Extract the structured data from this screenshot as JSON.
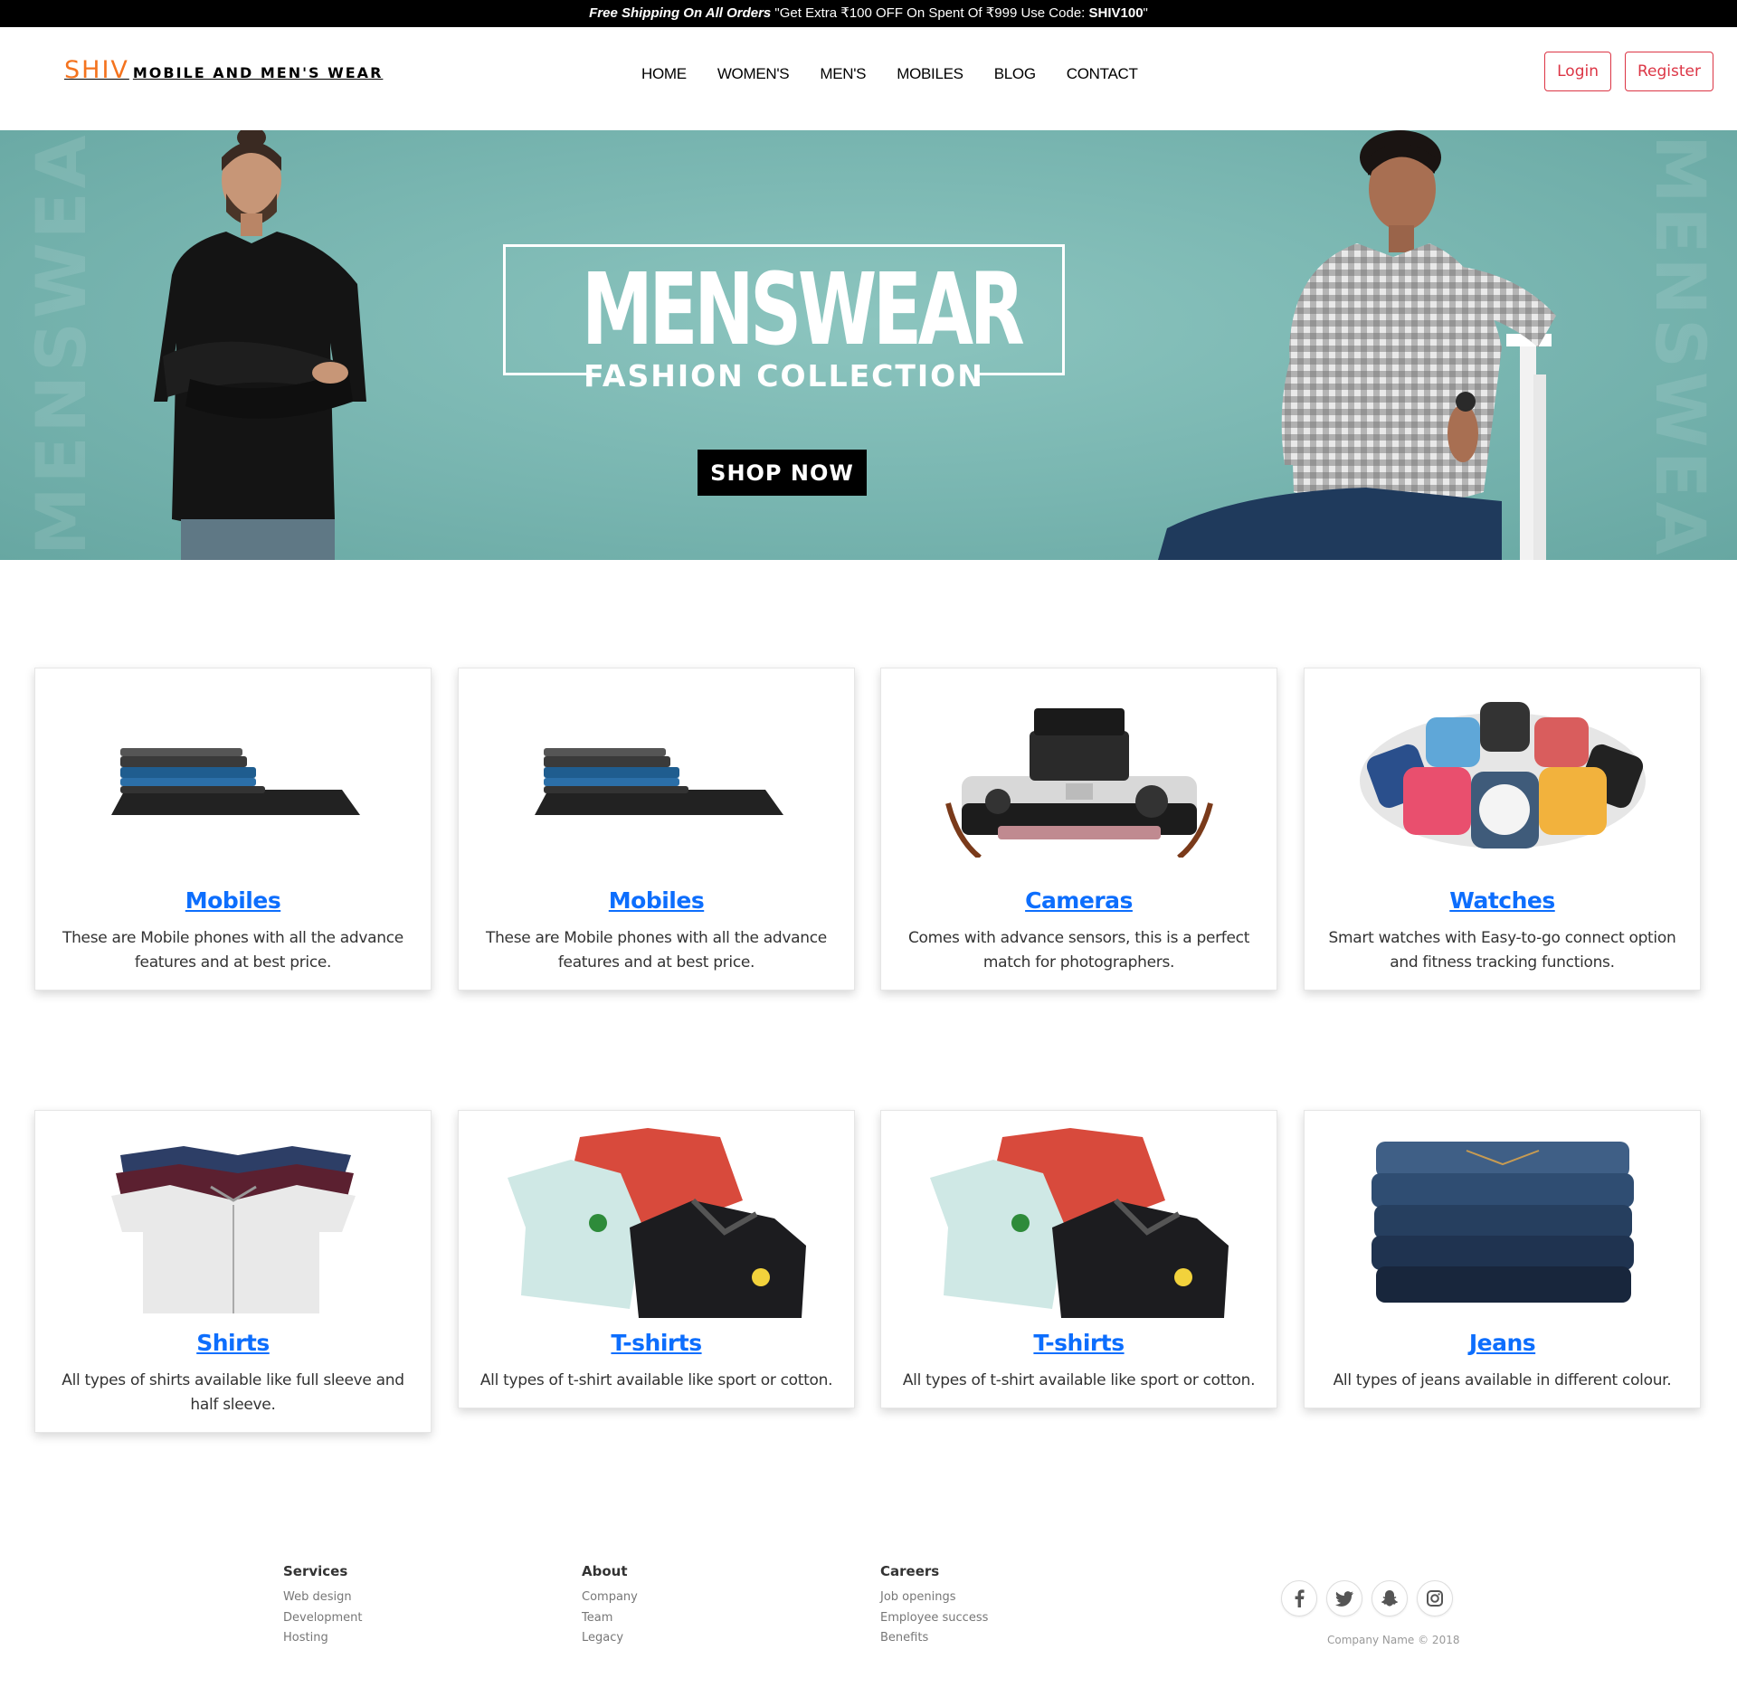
{
  "promo": {
    "bold": "Free Shipping On All Orders",
    "text": " \"Get Extra ₹100 OFF On Spent Of ₹999 Use Code: ",
    "code": "SHIV100",
    "end": "\""
  },
  "header": {
    "brand_main": "SHIV",
    "brand_rest": "MOBILE AND MEN'S WEAR",
    "nav": [
      "HOME",
      "WOMEN'S",
      "MEN'S",
      "MOBILES",
      "BLOG",
      "CONTACT"
    ],
    "login_label": "Login",
    "register_label": "Register"
  },
  "hero": {
    "vertical_left": "MENSWEAR",
    "vertical_right": "MENSWEAR",
    "title": "MENSWEAR",
    "subtitle": "FASHION COLLECTION",
    "button": "SHOP NOW",
    "colors": {
      "background": "#7ab8b2",
      "button": "#000000"
    }
  },
  "cards": [
    {
      "title": "Mobiles",
      "desc": "These are Mobile phones with all the advance features and at best price.",
      "icon": "phones-stack-image"
    },
    {
      "title": "Mobiles",
      "desc": "These are Mobile phones with all the advance features and at best price.",
      "icon": "phones-stack-image"
    },
    {
      "title": "Cameras",
      "desc": "Comes with advance sensors, this is a perfect match for photographers.",
      "icon": "camera-image"
    },
    {
      "title": "Watches",
      "desc": "Smart watches with Easy-to-go connect option and fitness tracking functions.",
      "icon": "watches-image"
    },
    {
      "title": "Shirts",
      "desc": "All types of shirts available like full sleeve and half sleeve.",
      "icon": "shirts-image"
    },
    {
      "title": "T-shirts",
      "desc": "All types of t-shirt available like sport or cotton.",
      "icon": "polo-tshirts-image"
    },
    {
      "title": "T-shirts",
      "desc": "All types of t-shirt available like sport or cotton.",
      "icon": "polo-tshirts-image"
    },
    {
      "title": "Jeans",
      "desc": "All types of jeans available in different colour.",
      "icon": "jeans-stack-image"
    }
  ],
  "footer": {
    "services": {
      "title": "Services",
      "links": [
        "Web design",
        "Development",
        "Hosting"
      ]
    },
    "about": {
      "title": "About",
      "links": [
        "Company",
        "Team",
        "Legacy"
      ]
    },
    "careers": {
      "title": "Careers",
      "links": [
        "Job openings",
        "Employee success",
        "Benefits"
      ]
    },
    "social": [
      "facebook-icon",
      "twitter-icon",
      "snapchat-icon",
      "instagram-icon"
    ],
    "copyright": "Company Name © 2018"
  },
  "colors": {
    "accent_orange": "#f4731e",
    "link_blue": "#0d6efd",
    "auth_red": "#dc3545"
  }
}
